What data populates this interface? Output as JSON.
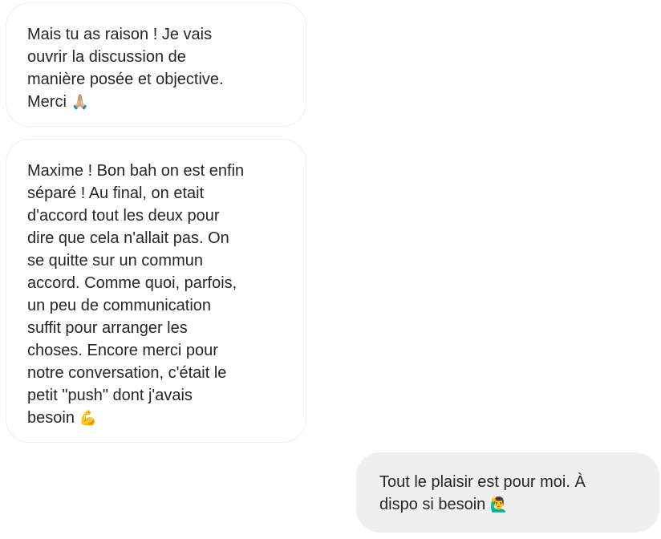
{
  "conversation": {
    "messages": [
      {
        "direction": "received",
        "text": "Mais tu as raison ! Je vais\nouvrir la discussion de\nmanière posée et objective.\nMerci ",
        "emoji": "🙏🏼"
      },
      {
        "direction": "received",
        "text": "Maxime ! Bon bah on est enfin\nséparé ! Au final, on etait\nd'accord tout les deux pour\ndire que cela n'allait pas. On\nse quitte sur un commun\naccord. Comme quoi, parfois,\nun peu de communication\nsuffit pour arranger les\nchoses. Encore merci pour\nnotre conversation, c'était le\npetit \"push\" dont j'avais\nbesoin ",
        "emoji": "💪"
      },
      {
        "direction": "sent",
        "text": "Tout le plaisir est pour moi. À\ndispo si besoin ",
        "emoji": "🙋‍♂️"
      }
    ]
  },
  "colors": {
    "received_bubble_bg": "#ffffff",
    "received_bubble_border": "#efefef",
    "sent_bubble_bg": "#efefef",
    "text": "#262626"
  }
}
